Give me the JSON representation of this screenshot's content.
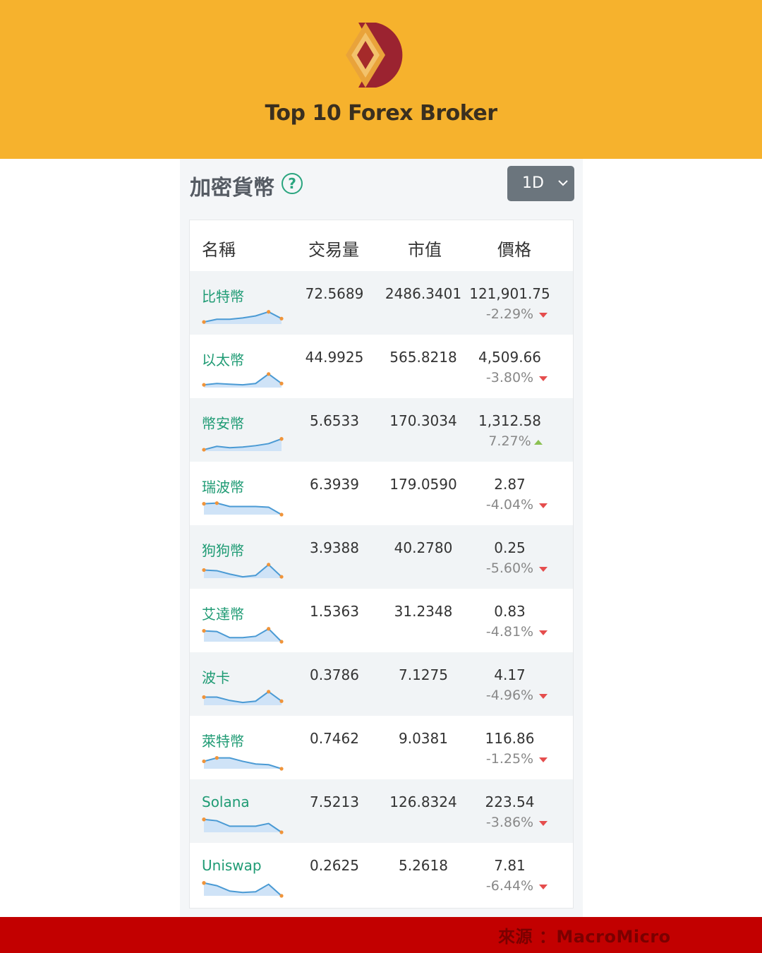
{
  "brand": {
    "title": "Top 10 Forex Broker",
    "logo_icon": "broker-logo-icon"
  },
  "widget": {
    "title": "加密貨幣",
    "help_symbol": "?",
    "range": {
      "selected": "1D"
    }
  },
  "table": {
    "headers": {
      "name": "名稱",
      "volume": "交易量",
      "market_cap": "市值",
      "price": "價格"
    },
    "rows": [
      {
        "name": "比特幣",
        "volume": "72.5689",
        "market_cap": "2486.3401",
        "price": "121,901.75",
        "change": "-2.29%",
        "direction": "down",
        "spark": [
          0.15,
          0.35,
          0.35,
          0.45,
          0.6,
          0.9,
          0.4
        ]
      },
      {
        "name": "以太幣",
        "volume": "44.9925",
        "market_cap": "565.8218",
        "price": "4,509.66",
        "change": "-3.80%",
        "direction": "down",
        "spark": [
          0.2,
          0.3,
          0.25,
          0.2,
          0.3,
          1.0,
          0.3
        ]
      },
      {
        "name": "幣安幣",
        "volume": "5.6533",
        "market_cap": "170.3034",
        "price": "1,312.58",
        "change": "7.27%",
        "direction": "up",
        "spark": [
          0.1,
          0.35,
          0.25,
          0.3,
          0.4,
          0.55,
          0.9
        ]
      },
      {
        "name": "瑞波幣",
        "volume": "6.3939",
        "market_cap": "179.0590",
        "price": "2.87",
        "change": "-4.04%",
        "direction": "down",
        "spark": [
          0.8,
          0.85,
          0.6,
          0.6,
          0.6,
          0.55,
          0.0
        ]
      },
      {
        "name": "狗狗幣",
        "volume": "3.9388",
        "market_cap": "40.2780",
        "price": "0.25",
        "change": "-5.60%",
        "direction": "down",
        "spark": [
          0.6,
          0.55,
          0.3,
          0.1,
          0.2,
          1.0,
          0.1
        ]
      },
      {
        "name": "艾達幣",
        "volume": "1.5363",
        "market_cap": "31.2348",
        "price": "0.83",
        "change": "-4.81%",
        "direction": "down",
        "spark": [
          0.8,
          0.75,
          0.3,
          0.3,
          0.4,
          0.95,
          0.0
        ]
      },
      {
        "name": "波卡",
        "volume": "0.3786",
        "market_cap": "7.1275",
        "price": "4.17",
        "change": "-4.96%",
        "direction": "down",
        "spark": [
          0.6,
          0.6,
          0.35,
          0.2,
          0.3,
          1.0,
          0.3
        ]
      },
      {
        "name": "萊特幣",
        "volume": "0.7462",
        "market_cap": "9.0381",
        "price": "116.86",
        "change": "-1.25%",
        "direction": "down",
        "spark": [
          0.55,
          0.8,
          0.8,
          0.55,
          0.35,
          0.3,
          0.0
        ]
      },
      {
        "name": "Solana",
        "volume": "7.5213",
        "market_cap": "126.8324",
        "price": "223.54",
        "change": "-3.86%",
        "direction": "down",
        "spark": [
          0.95,
          0.85,
          0.45,
          0.45,
          0.45,
          0.65,
          0.0
        ]
      },
      {
        "name": "Uniswap",
        "volume": "0.2625",
        "market_cap": "5.2618",
        "price": "7.81",
        "change": "-6.44%",
        "direction": "down",
        "spark": [
          0.95,
          0.75,
          0.35,
          0.25,
          0.3,
          0.85,
          0.0
        ]
      }
    ]
  },
  "footer": {
    "source": "來源 ：MacroMicro"
  },
  "colors": {
    "banner": "#f6b22d",
    "footer": "#c20000",
    "link": "#1f9b74",
    "down": "#e54d4d",
    "up": "#8cc152",
    "spark_line": "#4a9ad4",
    "spark_fill": "#cfe3f7",
    "spark_dot": "#f0943a"
  }
}
